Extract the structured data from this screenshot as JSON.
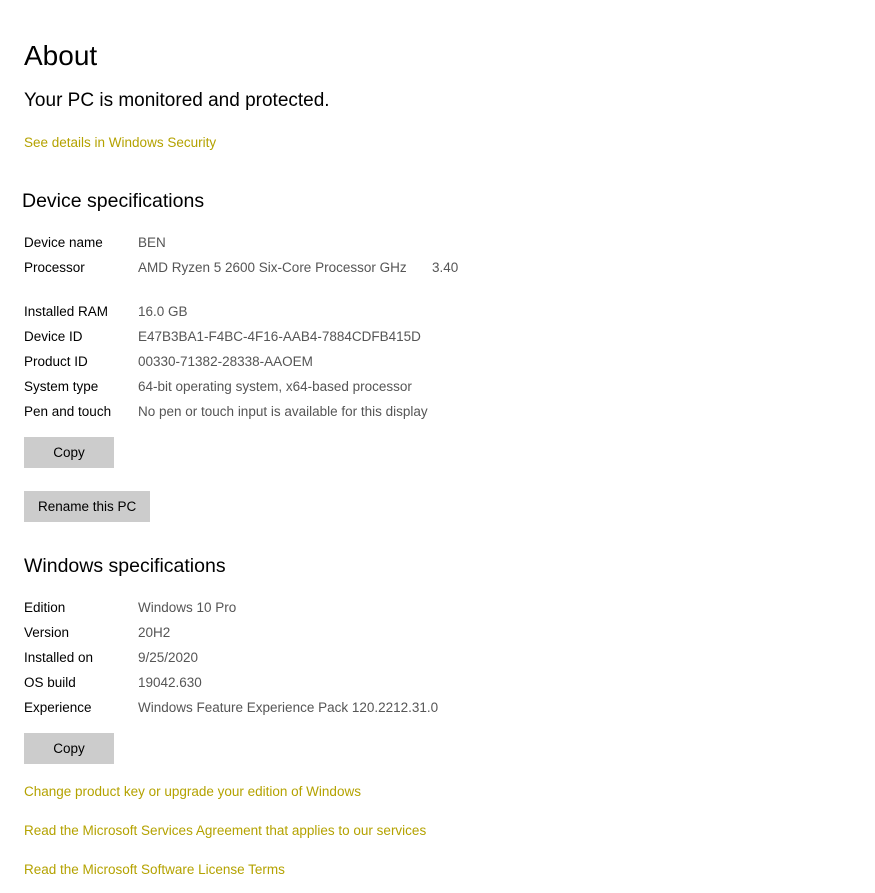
{
  "page": {
    "title": "About",
    "protection_status": "Your PC is monitored and protected.",
    "security_link": "See details in Windows Security"
  },
  "device_specs": {
    "heading": "Device specifications",
    "rows": [
      {
        "label": "Device name",
        "value": "BEN"
      },
      {
        "label": "Processor",
        "value": "AMD Ryzen 5 2600 Six-Core Processor GHz",
        "value_speed": "3.40"
      },
      {
        "label": "Installed RAM",
        "value": "16.0 GB"
      },
      {
        "label": "Device ID",
        "value": "E47B3BA1-F4BC-4F16-AAB4-7884CDFB415D"
      },
      {
        "label": "Product ID",
        "value": "00330-71382-28338-AAOEM"
      },
      {
        "label": "System type",
        "value": "64-bit operating system, x64-based processor"
      },
      {
        "label": "Pen and touch",
        "value": "No pen or touch input is available for this display"
      }
    ],
    "copy_label": "Copy",
    "rename_label": "Rename this PC"
  },
  "windows_specs": {
    "heading": "Windows specifications",
    "rows": [
      {
        "label": "Edition",
        "value": "Windows 10 Pro"
      },
      {
        "label": "Version",
        "value": "20H2"
      },
      {
        "label": "Installed on",
        "value": "9/25/2020"
      },
      {
        "label": "OS build",
        "value": "19042.630"
      },
      {
        "label": "Experience",
        "value": "Windows Feature Experience Pack 120.2212.31.0"
      }
    ],
    "copy_label": "Copy"
  },
  "links": {
    "product_key": "Change product key or upgrade your edition of Windows",
    "services_agreement": "Read the Microsoft Services Agreement that applies to our services",
    "license_terms": "Read the Microsoft Software License Terms"
  },
  "colors": {
    "link": "#b4a200",
    "button_bg": "#cccccc",
    "value_text": "#555555"
  }
}
